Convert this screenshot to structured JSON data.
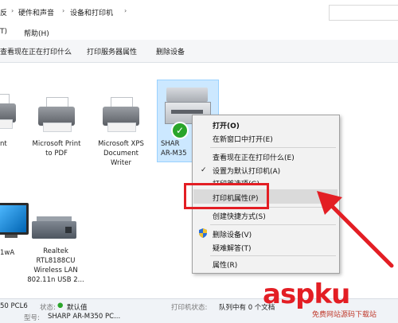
{
  "breadcrumb": {
    "items": [
      "反",
      "硬件和声音",
      "设备和打印机"
    ]
  },
  "menubar": {
    "items": [
      "T)",
      "帮助(H)"
    ]
  },
  "toolbar": {
    "items": [
      "查看现在正在打印什么",
      "打印服务器属性",
      "删除设备"
    ]
  },
  "devices": {
    "row1": [
      {
        "label_lines": [
          "nt"
        ]
      },
      {
        "label_lines": [
          "Microsoft Print",
          "to PDF"
        ]
      },
      {
        "label_lines": [
          "Microsoft XPS",
          "Document",
          "Writer"
        ]
      },
      {
        "label_lines": [
          "SHAR",
          "AR-M35"
        ]
      }
    ],
    "row2": [
      {
        "label_lines": [
          "1wA"
        ]
      },
      {
        "label_lines": [
          "Realtek",
          "RTL8188CU",
          "Wireless LAN",
          "802.11n USB 2..."
        ]
      }
    ]
  },
  "context_menu": {
    "items": [
      {
        "label": "打开(O)",
        "bold": true
      },
      {
        "label": "在新窗口中打开(E)"
      },
      {
        "label": "查看现在正在打印什么(E)"
      },
      {
        "label": "设置为默认打印机(A)",
        "checked": true
      },
      {
        "label": "打印首选项(G)"
      },
      {
        "label": "打印机属性(P)",
        "highlighted": true
      },
      {
        "label": "创建快捷方式(S)"
      },
      {
        "label": "删除设备(V)",
        "icon": "shield-icon"
      },
      {
        "label": "疑难解答(T)"
      },
      {
        "label": "属性(R)"
      }
    ]
  },
  "statusbar": {
    "model_fragment": "50 PCL6",
    "state_label": "状态:",
    "state_value": "默认值",
    "printer_status_label": "打印机状态:",
    "printer_status_value": "队列中有 0 个文档",
    "model_label": "型号:",
    "model_value": "SHARP AR-M350 PC..."
  },
  "watermark": {
    "main": "aspku",
    "sub": "免费网站源码下载站"
  },
  "colors": {
    "accent_red": "#e31e24",
    "selection_blue": "#cce8ff",
    "default_check_green": "#2aa52a"
  }
}
